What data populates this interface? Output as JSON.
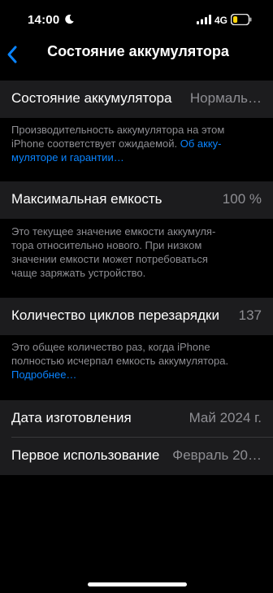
{
  "status_bar": {
    "time": "14:00",
    "network": "4G",
    "battery_level": 0.3,
    "battery_color": "#ffd60a"
  },
  "nav": {
    "back_icon": "chevron-left-icon",
    "title": "Состояние аккумулятора"
  },
  "battery_health": {
    "label": "Состояние аккумулятора",
    "value": "Нормаль…",
    "footnote_line1": "Производительность аккумулятора на этом",
    "footnote_line2_text": "iPhone соответствует ожидаемой. ",
    "footnote_line2_link": "Об акку-",
    "footnote_line3_link": "муляторе и гарантии…"
  },
  "max_capacity": {
    "label": "Максимальная емкость",
    "value": "100 %",
    "footnote_lines": [
      "Это текущее значение емкости аккумуля-",
      "тора относительно нового. При низком",
      "значении емкости может потребоваться",
      "чаще заряжать устройство."
    ]
  },
  "cycle_count": {
    "label": "Количество циклов перезарядки",
    "value": "137",
    "footnote_lines": [
      "Это общее количество раз, когда iPhone",
      "полностью исчерпал емкость аккумулятора."
    ],
    "footnote_link": "Подробнее…"
  },
  "manufacture_date": {
    "label": "Дата изготовления",
    "value": "Май 2024 г."
  },
  "first_use": {
    "label": "Первое использование",
    "value": "Февраль 20…"
  },
  "colors": {
    "accent": "#0a84ff",
    "cell_background": "#1c1c1e",
    "secondary_text": "#8e8e93"
  }
}
